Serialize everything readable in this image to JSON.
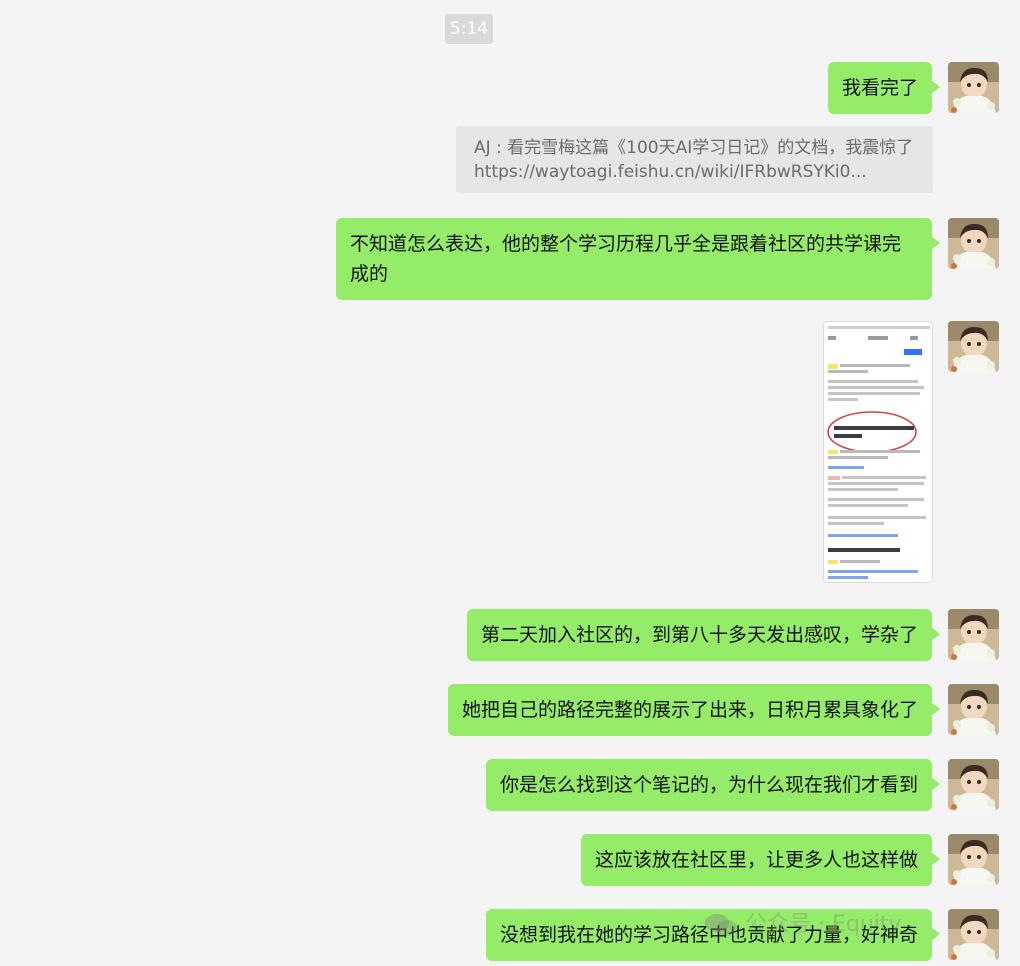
{
  "chat": {
    "timestamp": "5:14",
    "messages": [
      {
        "text": "我看完了"
      },
      {
        "quote": "AJ : 看完雪梅这篇《100天AI学习日记》的文档，我震惊了https://waytoagi.feishu.cn/wiki/IFRbwRSYKi0..."
      },
      {
        "text": "不知道怎么表达，他的整个学习历程几乎全是跟着社区的共学课完成的"
      },
      {
        "image": "screenshot-thumbnail"
      },
      {
        "text": "第二天加入社区的，到第八十多天发出感叹，学杂了"
      },
      {
        "text": "她把自己的路径完整的展示了出来，日积月累具象化了"
      },
      {
        "text": "你是怎么找到这个笔记的，为什么现在我们才看到"
      },
      {
        "text": "这应该放在社区里，让更多人也这样做"
      },
      {
        "text": "没想到我在她的学习路径中也贡献了力量，好神奇"
      }
    ]
  },
  "watermark": {
    "text": "公众号 · Equity"
  },
  "colors": {
    "background": "#f4f4f4",
    "bubble": "#95ec69",
    "quote_bg": "#e6e6e6",
    "timestamp_bg": "#dadada"
  }
}
